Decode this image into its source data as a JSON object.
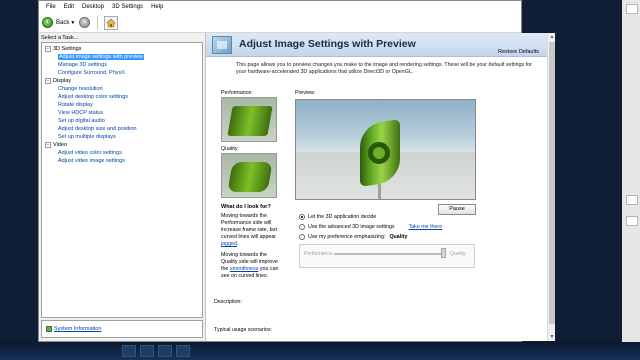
{
  "menubar": {
    "items": [
      "File",
      "Edit",
      "Desktop",
      "3D Settings",
      "Help"
    ]
  },
  "toolbar": {
    "back_label": "Back"
  },
  "sidebar": {
    "task_label": "Select a Task...",
    "groups": [
      {
        "label": "3D Settings",
        "items": [
          "Adjust image settings with preview",
          "Manage 3D settings",
          "Configure Surround, PhysX"
        ]
      },
      {
        "label": "Display",
        "items": [
          "Change resolution",
          "Adjust desktop color settings",
          "Rotate display",
          "View HDCP status",
          "Set up digital audio",
          "Adjust desktop size and position",
          "Set up multiple displays"
        ]
      },
      {
        "label": "Video",
        "items": [
          "Adjust video color settings",
          "Adjust video image settings"
        ]
      }
    ],
    "system_info": "System Information"
  },
  "content": {
    "title": "Adjust Image Settings with Preview",
    "restore_defaults": "Restore Defaults",
    "intro": "This page allows you to preview changes you make to the image and rendering settings. These will be your default settings for your hardware-accelerated 3D applications that utilize Direct3D or OpenGL.",
    "performance_label": "Performance:",
    "quality_label": "Quality:",
    "what_do_i_look_for": "What do I look for?",
    "help1_text": "Moving towards the Performance side will increase frame rate, but curved lines will appear",
    "help1_link": "jagged",
    "help2_text": "Moving towards the Quality side will improve the",
    "help2_link": "smoothness",
    "help2_suffix": "you can see on curved lines.",
    "preview_label": "Preview:",
    "pause_label": "Pause",
    "radio1": "Let the 3D application decide",
    "radio2": "Use the advanced 3D image settings",
    "take_me_there": "Take me there",
    "radio3": "Use my preference emphasizing:",
    "preference_value": "Quality",
    "slider_left": "Performance",
    "slider_right": "Quality",
    "slider_level": 1.0,
    "description_label": "Description:",
    "usage_label": "Typical usage scenarios:"
  },
  "colors": {
    "accent_green": "#76b900",
    "link_blue": "#0645ad",
    "selection_blue": "#3399ff"
  }
}
